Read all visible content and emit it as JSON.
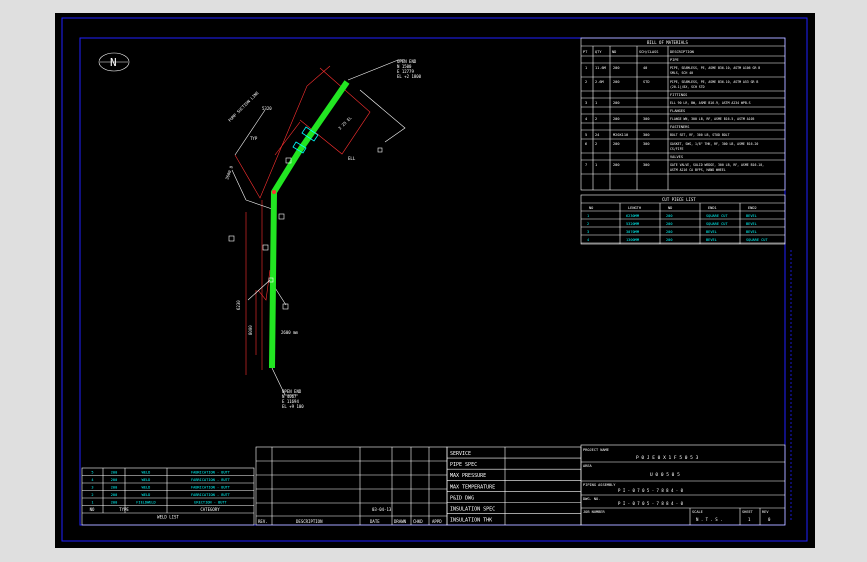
{
  "north_label": "N",
  "bom": {
    "title": "BILL OF MATERIALS",
    "headers": [
      "PT",
      "QTY",
      "ND",
      "SCH/CLASS",
      "DESCRIPTION"
    ],
    "sections": [
      {
        "name": "PIPE",
        "rows": [
          {
            "pt": "1",
            "qty": "11.6M",
            "nd": "200",
            "sch": "40",
            "desc1": "PIPE, SEAMLESS, PE, ASME B36.10, ASTM A106 GR B",
            "desc2": "SMLS, SCH 40"
          },
          {
            "pt": "2",
            "qty": "2.6M",
            "nd": "200",
            "sch": "STD",
            "desc1": "PIPE, SEAMLESS, PE, ASME B36.10, ASTM A53 GR B",
            "desc2": "(20-1)/8X, SCH STD"
          }
        ]
      },
      {
        "name": "FITTINGS",
        "rows": [
          {
            "pt": "3",
            "qty": "1",
            "nd": "200",
            "sch": "",
            "desc1": "ELL 90 LR, BW, ASME B16.9, ASTM A234 WPB-S",
            "desc2": ""
          }
        ]
      },
      {
        "name": "FLANGES",
        "rows": [
          {
            "pt": "4",
            "qty": "2",
            "nd": "200",
            "sch": "300",
            "desc1": "FLANGE WN, 300 LB, RF, ASME B16.5, ASTM A105",
            "desc2": ""
          }
        ]
      },
      {
        "name": "FASTENERS",
        "rows": [
          {
            "pt": "5",
            "qty": "24",
            "nd": "M20X110",
            "sch": "300",
            "desc1": "BOLT SET, RF, 300 LB, STUD BOLT",
            "desc2": ""
          },
          {
            "pt": "6",
            "qty": "2",
            "nd": "200",
            "sch": "300",
            "desc1": "GASKET, SWG, 1/8\" THK, RF, 300 LB, ASME B16.20",
            "desc2": "CS/FIFE"
          }
        ]
      },
      {
        "name": "VALVES",
        "rows": [
          {
            "pt": "7",
            "qty": "1",
            "nd": "200",
            "sch": "300",
            "desc1": "GATE VALVE, SOLID WEDGE, 300 LB, RF, ASME B16.10,",
            "desc2": "ASTM A216 CA BYPS, HAND WHEEL"
          }
        ]
      }
    ]
  },
  "cut_list": {
    "title": "CUT PIECE LIST",
    "headers": [
      "NO",
      "LENGTH",
      "ND",
      "END1",
      "END2"
    ],
    "rows": [
      [
        "1",
        "6230MM",
        "200",
        "SQUARE CUT",
        "BEVEL"
      ],
      [
        "2",
        "5320MM",
        "200",
        "SQUARE CUT",
        "BEVEL"
      ],
      [
        "3",
        "3070MM",
        "200",
        "BEVEL",
        "BEVEL"
      ],
      [
        "4",
        "1300MM",
        "200",
        "BEVEL",
        "SQUARE CUT"
      ]
    ]
  },
  "weld_list": {
    "title": "WELD LIST",
    "headers": [
      "NO",
      "TYPE",
      "CATEGORY"
    ],
    "rows": [
      [
        "5",
        "200",
        "WELD",
        "FABRICATION - BUTT"
      ],
      [
        "4",
        "200",
        "WELD",
        "FABRICATION - BUTT"
      ],
      [
        "3",
        "200",
        "WELD",
        "FABRICATION - BUTT"
      ],
      [
        "2",
        "200",
        "WELD",
        "FABRICATION - BUTT"
      ],
      [
        "1",
        "200",
        "FIELDWELD",
        "ERECTION - BUTT"
      ]
    ]
  },
  "revision": {
    "entry": "03-04-13",
    "headers": [
      "REV.",
      "DESCRIPTION",
      "DATE",
      "DRAWN",
      "CHKD",
      "APPD"
    ]
  },
  "spec_labels": [
    "SERVICE",
    "PIPE SPEC",
    "MAX PRESSURE",
    "MAX TEMPERATURE",
    "P&ID DWG",
    "INSULATION SPEC",
    "INSULATION THK"
  ],
  "title_block": {
    "project_label": "PROJECT NAME",
    "project_value": "P 0 J E 0 X 1 F 5 0 5 3",
    "area_label": "AREA",
    "area_value": "U 0 0 5 0 5",
    "piping_label": "PIPING ASSEMBLY",
    "piping_value": "P I - 0 7 0 5 - 7 8 8 4 - 0",
    "dwg_label": "DWG. NO.",
    "dwg_value": "P I - 0 7 0 5 - 7 8 8 4 - 0",
    "job_label": "JOB NUMBER",
    "scale_label": "SCALE",
    "scale_value": "N . T . S .",
    "sheet_label": "SHEET",
    "sheet_value": "1",
    "rev_label": "REV",
    "rev_value": "0"
  },
  "iso_annotations": {
    "top_label": [
      "OPEN END",
      "N 1500",
      "E 12779",
      "EL +2 1800"
    ],
    "bottom_label": [
      "OPEN END",
      "N 4067",
      "E 11694",
      "EL +9 100"
    ],
    "dim_1": "2600 mm",
    "dim_2": "5320",
    "dim_3": "6230",
    "elbow_tag": "ELL",
    "valve_tag": "3 25 EL",
    "angle_note": "3600 D",
    "side_note_1": "PUMP SUCTION LINE",
    "side_note_2": "TYP",
    "side_note_3": "8000"
  },
  "colors": {
    "frame": "#1e1eff",
    "pipe": "#22e622",
    "dimension": "#ff3030",
    "text": "#ffffff",
    "weld_text": "#00ffff"
  }
}
